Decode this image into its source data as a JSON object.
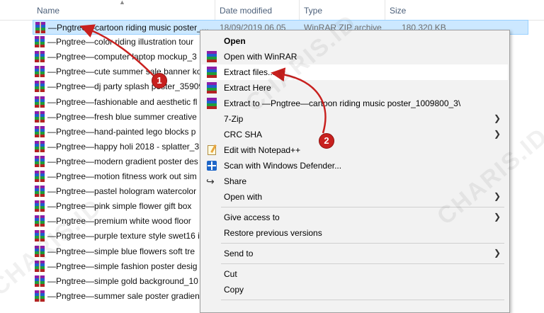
{
  "columns": {
    "name": "Name",
    "date_modified": "Date modified",
    "type": "Type",
    "size": "Size"
  },
  "selected_file": {
    "name": "—Pngtree—cartoon riding music poster_...",
    "date": "18/09/2019 06.05",
    "type": "WinRAR ZIP archive",
    "size": "180.320 KB"
  },
  "files": [
    "—Pngtree—cartoon riding music poster_",
    "—Pngtree—color riding illustration tour",
    "—Pngtree—computer laptop mockup_3",
    "—Pngtree—cute summer sale banner ko",
    "—Pngtree—dj party splash poster_35909",
    "—Pngtree—fashionable and aesthetic fl",
    "—Pngtree—fresh blue summer creative",
    "—Pngtree—hand-painted lego blocks p",
    "—Pngtree—happy holi 2018 - splatter_3",
    "—Pngtree—modern gradient poster des",
    "—Pngtree—motion fitness work out sim",
    "—Pngtree—pastel hologram watercolor",
    "—Pngtree—pink simple flower gift box",
    "—Pngtree—premium white wood floor",
    "—Pngtree—purple texture style swet16 i",
    "—Pngtree—simple blue flowers soft tre",
    "—Pngtree—simple fashion poster desig",
    "—Pngtree—simple gold background_10",
    "—Pngtree—summer sale poster gradien"
  ],
  "context_menu": {
    "open": "Open",
    "open_with_winrar": "Open with WinRAR",
    "extract_files": "Extract files...",
    "extract_here": "Extract Here",
    "extract_to": "Extract to —Pngtree—cartoon riding music poster_1009800_3\\",
    "seven_zip": "7-Zip",
    "crc_sha": "CRC SHA",
    "edit_notepad": "Edit with Notepad++",
    "scan_defender": "Scan with Windows Defender...",
    "share": "Share",
    "open_with": "Open with",
    "give_access": "Give access to",
    "restore_versions": "Restore previous versions",
    "send_to": "Send to",
    "cut": "Cut",
    "copy": "Copy"
  },
  "annotations": {
    "step1": "1",
    "step2": "2",
    "color": "#c8201e"
  },
  "watermark": "CHARIS.ID"
}
